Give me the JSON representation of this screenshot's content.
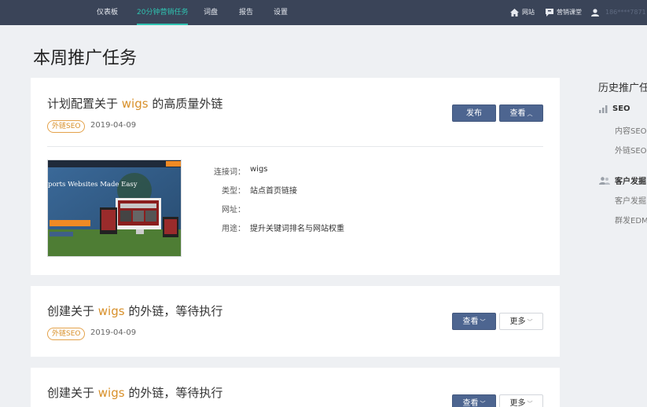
{
  "nav": {
    "items": [
      {
        "label": "仪表板"
      },
      {
        "label": "20分钟营销任务"
      },
      {
        "label": "词盘"
      },
      {
        "label": "报告"
      },
      {
        "label": "设置"
      }
    ],
    "website_label": "网站",
    "marketing_class_label": "营销课堂",
    "phone": "186****7871",
    "active_color": "#2fc2b0"
  },
  "page_title": "本周推广任务",
  "tasks": [
    {
      "title_prefix": "计划配置关于 ",
      "keyword": "wigs",
      "title_suffix": " 的高质量外链",
      "tag": "外链SEO",
      "date": "2019-04-09",
      "publish_label": "发布",
      "view_label": "查看",
      "details": {
        "keyword_label": "连接词：",
        "keyword_value": "wigs",
        "type_label": "类型：",
        "type_value": "站点首页链接",
        "url_label": "网址：",
        "url_value": "",
        "purpose_label": "用途：",
        "purpose_value": "提升关键词排名与网站权重"
      },
      "thumb_headline": "ports Websites Made Easy"
    },
    {
      "title_prefix": "创建关于 ",
      "keyword": "wigs",
      "title_suffix": " 的外链，等待执行",
      "tag": "外链SEO",
      "date": "2019-04-09",
      "view_label": "查看",
      "more_label": "更多"
    },
    {
      "title_prefix": "创建关于 ",
      "keyword": "wigs",
      "title_suffix": " 的外链，等待执行",
      "view_label": "查看",
      "more_label": "更多"
    }
  ],
  "sidebar": {
    "title": "历史推广任",
    "groups": [
      {
        "label": "SEO",
        "items": [
          "内容SEO",
          "外链SEO"
        ]
      },
      {
        "label": "客户发掘",
        "items": [
          "客户发掘",
          "群发EDM"
        ]
      }
    ]
  },
  "colors": {
    "nav_bg": "#3a4458",
    "primary_button": "#4d6590",
    "keyword": "#d8902a"
  }
}
